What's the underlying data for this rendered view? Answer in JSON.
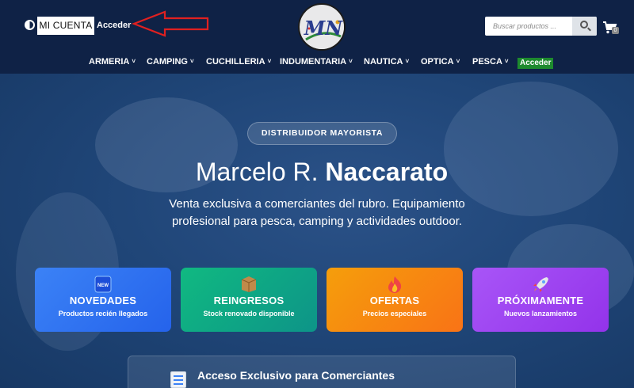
{
  "header": {
    "account_label": "MI CUENTA",
    "login_label": "Acceder",
    "logo_text": "MN",
    "search": {
      "placeholder": "Buscar productos ..."
    },
    "cart_count": "0"
  },
  "nav": {
    "items": [
      {
        "label": "ARMERIA"
      },
      {
        "label": "CAMPING"
      },
      {
        "label": "CUCHILLERIA"
      },
      {
        "label": "INDUMENTARIA"
      },
      {
        "label": "NAUTICA"
      },
      {
        "label": "OPTICA"
      },
      {
        "label": "PESCA"
      }
    ],
    "caret": "˅",
    "login_label": "Acceder"
  },
  "hero": {
    "badge": "DISTRIBUIDOR MAYORISTA",
    "title_first": "Marcelo R.",
    "title_last": "Naccarato",
    "subtitle": "Venta exclusiva a comerciantes del rubro. Equipamiento profesional para pesca, camping y actividades outdoor."
  },
  "cards": [
    {
      "icon": "new-icon",
      "icon_text": "NEW",
      "title": "NOVEDADES",
      "subtitle": "Productos recién llegados",
      "color": "#2f6ff0"
    },
    {
      "icon": "box-icon",
      "title": "REINGRESOS",
      "subtitle": "Stock renovado disponible",
      "color": "#0fa68a"
    },
    {
      "icon": "fire-icon",
      "title": "OFERTAS",
      "subtitle": "Precios especiales",
      "color": "#f48a12"
    },
    {
      "icon": "rocket-icon",
      "title": "PRÓXIMAMENTE",
      "subtitle": "Nuevos lanzamientos",
      "color": "#a24ee9"
    }
  ],
  "access": {
    "icon": "calculator-icon",
    "title": "Acceso Exclusivo para Comerciantes"
  },
  "colors": {
    "header_bg": "#0f2246",
    "hero_bg": "#1f4577",
    "login_green": "#1e8a2e",
    "arrow_red": "#e02020"
  }
}
